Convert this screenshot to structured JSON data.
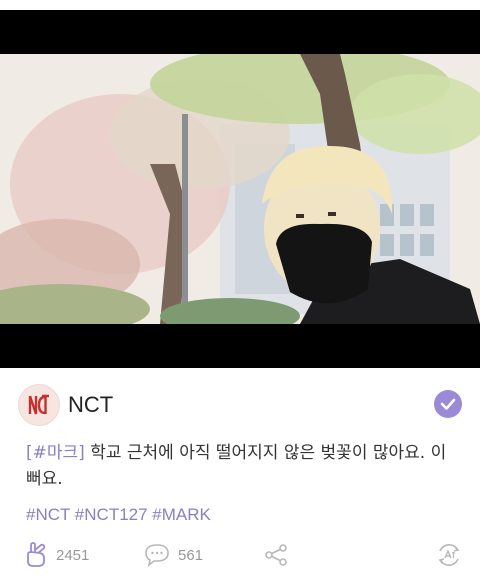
{
  "post": {
    "channel_name": "NCT",
    "caption_tag": "[#마크]",
    "caption_text": " 학교 근처에 아직 떨어지지 않은 벚꽃이 많아요. 이뻐요.",
    "hashtags": "#NCT #NCT127 #MARK"
  },
  "actions": {
    "likes": "2451",
    "comments": "561"
  },
  "colors": {
    "accent": "#9b8ad6",
    "hashtag": "#8b7fc0",
    "brand_red": "#c8302d"
  },
  "icons": {
    "avatar": "nct-logo-icon",
    "verified": "check-icon",
    "like": "finger-heart-icon",
    "comment": "comment-icon",
    "share": "share-icon",
    "translate": "translate-icon"
  }
}
